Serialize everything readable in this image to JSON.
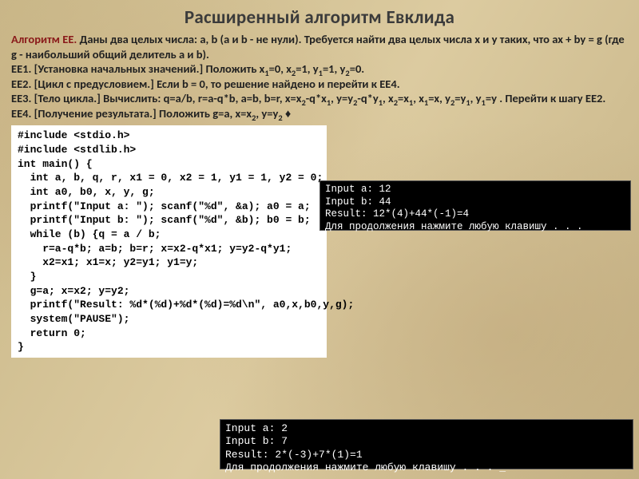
{
  "title": "Расширенный алгоритм Евклида",
  "desc": {
    "lead": "Алгоритм EE.",
    "intro": " Даны два целых числа: a, b (a и b - не нули). Требуется найти два целых числа x и y таких, что ax + by = g (где g - наибольший общий делитель a и b).",
    "ee1_label": "EE1.",
    "ee1_text": " [Установка начальных значений.] Положить x",
    "ee1_rest": "=0.",
    "ee2_label": "EE2.",
    "ee2_text": " [Цикл с предусловием.] Если b = 0, то решение найдено и перейти к EE4.",
    "ee3_label": "EE3.",
    "ee3_text": " [Тело цикла.] Вычислить: q=a/b, r=a-q*b, a=b, b=r, x=x",
    "ee3_p2a": "-q*x",
    "ee3_p2b": ", y=y",
    "ee3_p2c": "-q*y",
    "ee3_p2d": ", x",
    "ee3_p2e": "=x",
    "ee3_p2f": ", x",
    "ee3_p2g": "=x, y",
    "ee3_p2h": "=y",
    "ee3_p2i": ", y",
    "ee3_p2j": "=y . Перейти к шагу EE2.",
    "ee4_label": "EE4.",
    "ee4_text": " [Получение результата.] Положить g=a, x=x",
    "ee4_rest": " ♦",
    "eq0": "=0, x",
    "eq1a": "=1, y",
    "eq1b": "=1, y",
    "comma_yy": ", y=y",
    "s1": "1",
    "s2": "2"
  },
  "code": "#include <stdio.h>\n#include <stdlib.h>\nint main() {\n  int a, b, q, r, x1 = 0, x2 = 1, y1 = 1, y2 = 0;\n  int a0, b0, x, y, g;\n  printf(\"Input a: \"); scanf(\"%d\", &a); a0 = a;\n  printf(\"Input b: \"); scanf(\"%d\", &b); b0 = b;\n  while (b) {q = a / b;\n    r=a-q*b; a=b; b=r; x=x2-q*x1; y=y2-q*y1;\n    x2=x1; x1=x; y2=y1; y1=y;\n  }\n  g=a; x=x2; y=y2;\n  printf(\"Result: %d*(%d)+%d*(%d)=%d\\n\", a0,x,b0,y,g);\n  system(\"PAUSE\");\n  return 0;\n}",
  "terminal1": "Input a: 12\nInput b: 44\nResult: 12*(4)+44*(-1)=4\nДля продолжения нажмите любую клавишу . . .",
  "terminal2": "Input a: 2\nInput b: 7\nResult: 2*(-3)+7*(1)=1\nДля продолжения нажмите любую клавишу . . . _"
}
